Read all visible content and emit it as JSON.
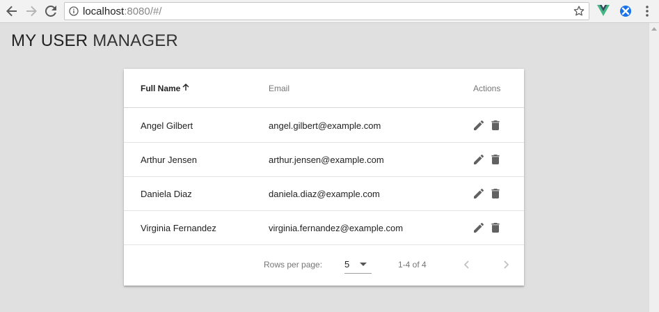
{
  "browser": {
    "url_host": "localhost",
    "url_rest": ":8080/#/",
    "icons": [
      "back-arrow-icon",
      "forward-arrow-icon",
      "reload-icon",
      "info-icon",
      "star-icon",
      "vue-devtools-icon",
      "extension-icon",
      "menu-dots-icon"
    ]
  },
  "page": {
    "title_bold": "MY USER",
    "title_light": "MANAGER"
  },
  "table": {
    "headers": {
      "name": "Full Name",
      "email": "Email",
      "actions": "Actions"
    },
    "sort_icon": "arrow-up-icon",
    "rows": [
      {
        "name": "Angel Gilbert",
        "email": "angel.gilbert@example.com"
      },
      {
        "name": "Arthur Jensen",
        "email": "arthur.jensen@example.com"
      },
      {
        "name": "Daniela Diaz",
        "email": "daniela.diaz@example.com"
      },
      {
        "name": "Virginia Fernandez",
        "email": "virginia.fernandez@example.com"
      }
    ],
    "action_icons": [
      "edit-pencil-icon",
      "delete-trash-icon"
    ]
  },
  "pagination": {
    "rows_per_page_label": "Rows per page:",
    "rows_per_page_value": "5",
    "range_text": "1-4 of 4"
  },
  "colors": {
    "page_background": "#e0e0e0",
    "card_background": "#ffffff",
    "vue_green": "#41b883",
    "extension_blue": "#1a73e8"
  }
}
